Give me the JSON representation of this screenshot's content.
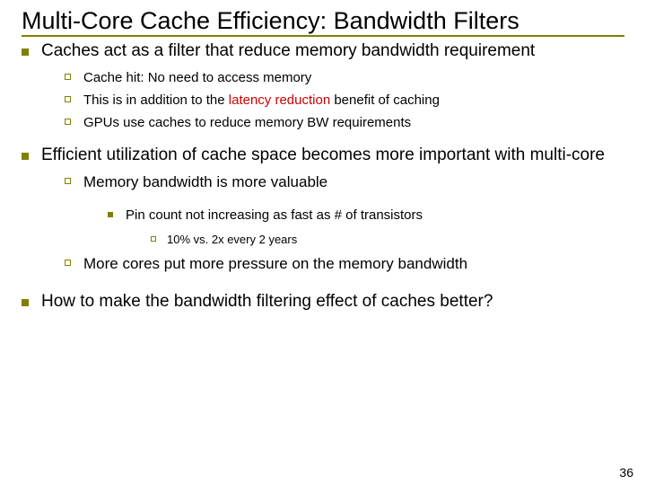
{
  "title": "Multi-Core Cache Efficiency: Bandwidth Filters",
  "b1": {
    "pre": "Caches act as a filter that reduce memory bandwidth requirement",
    "sub": [
      "Cache hit: No need to access memory",
      "This is in addition to the ",
      "latency reduction",
      " benefit of caching",
      "GPUs use caches to reduce memory BW requirements"
    ]
  },
  "b2": {
    "pre": "Efficient utilization of cache space becomes more important with multi-core",
    "sub1": "Memory bandwidth is more valuable",
    "sub1a": "Pin count not increasing as fast as # of transistors",
    "sub1a1": "10% vs. 2x every 2 years",
    "sub2": "More cores put more pressure on the memory bandwidth"
  },
  "b3": "How to make the bandwidth filtering effect of caches better?",
  "pagenum": "36"
}
